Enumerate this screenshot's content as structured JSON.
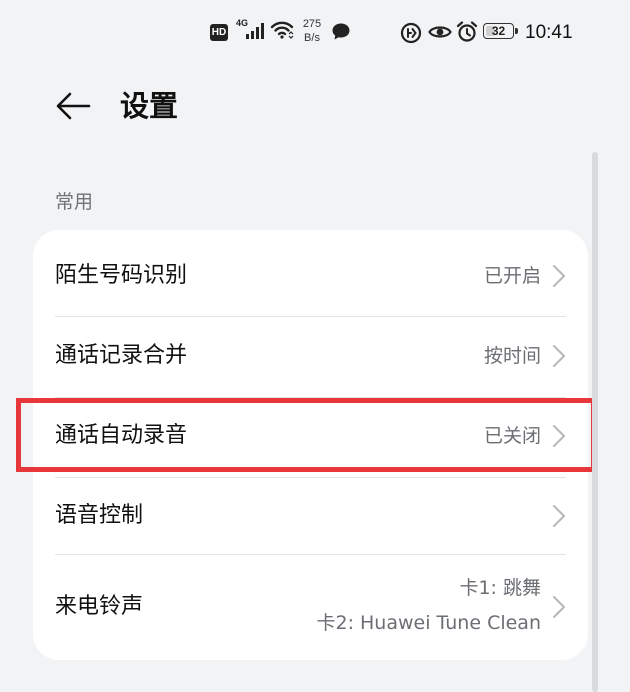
{
  "status_bar": {
    "hd": "HD",
    "network_type": "4G",
    "net_speed_value": "275",
    "net_speed_unit": "B/s",
    "battery_level": "32",
    "time": "10:41"
  },
  "header": {
    "title": "设置"
  },
  "section": {
    "label": "常用"
  },
  "rows": [
    {
      "label": "陌生号码识别",
      "value": "已开启"
    },
    {
      "label": "通话记录合并",
      "value": "按时间"
    },
    {
      "label": "通话自动录音",
      "value": "已关闭"
    },
    {
      "label": "语音控制",
      "value": ""
    },
    {
      "label": "来电铃声",
      "value": "卡1: 跳舞",
      "value_2": "卡2: Huawei Tune Clean"
    }
  ],
  "colors": {
    "background": "#f1f3f5",
    "card": "#ffffff",
    "highlight": "#e8373b",
    "secondary_text": "#6b6e73"
  }
}
